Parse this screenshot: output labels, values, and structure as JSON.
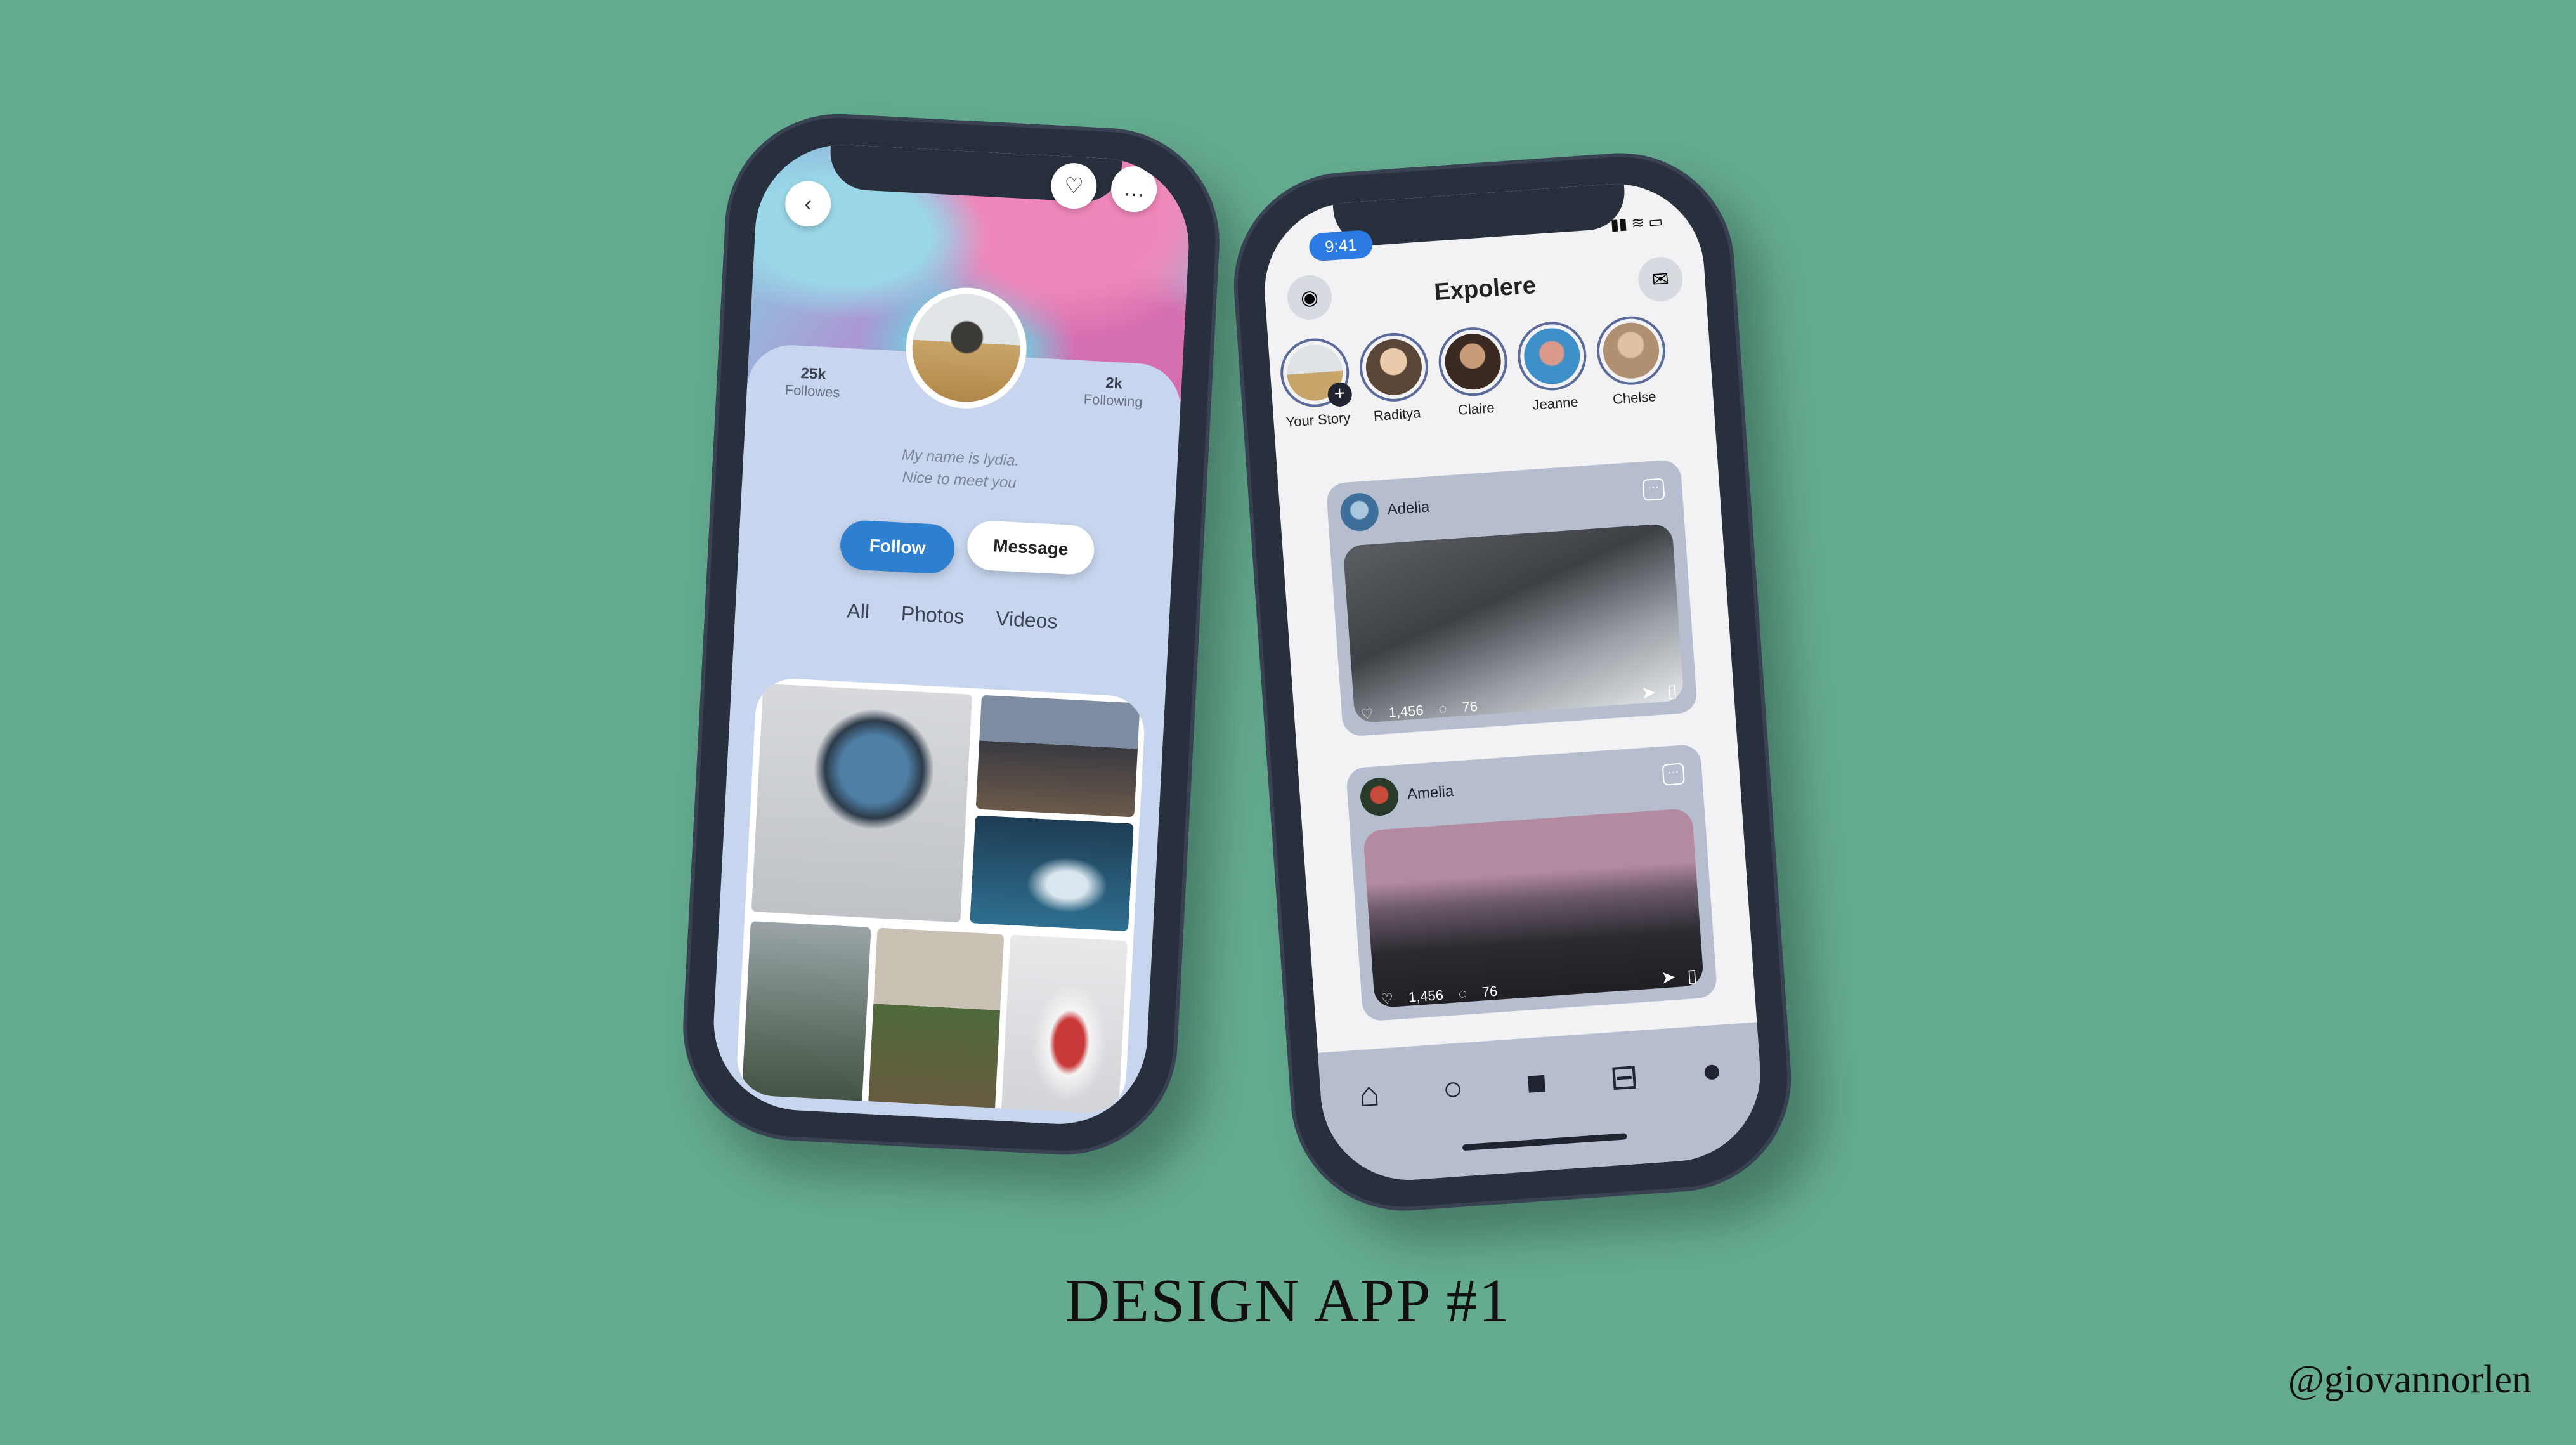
{
  "profile": {
    "followers_count": "25k",
    "followers_label": "Followes",
    "following_count": "2k",
    "following_label": "Following",
    "bio_line1": "My name is lydia.",
    "bio_line2": "Nice to meet you",
    "follow_label": "Follow",
    "message_label": "Message",
    "tabs": [
      "All",
      "Photos",
      "Videos"
    ],
    "accent": "#2f7fd0"
  },
  "feed": {
    "status_time": "9:41",
    "title": "Expolere",
    "stories": [
      "Your Story",
      "Raditya",
      "Claire",
      "Jeanne",
      "Chelse"
    ],
    "posts": [
      {
        "author": "Adelia",
        "likes": "1,456",
        "comments": "76"
      },
      {
        "author": "Amelia",
        "likes": "1,456",
        "comments": "76"
      }
    ],
    "nav_icons": [
      "home-icon",
      "search-icon",
      "video-icon",
      "basket-icon",
      "profile-avatar"
    ]
  },
  "caption": "DESIGN APP #1",
  "credit": "@giovannorlen"
}
